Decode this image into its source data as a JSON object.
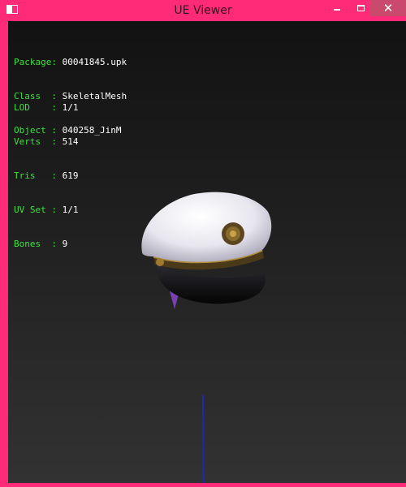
{
  "window": {
    "title": "UE Viewer",
    "accent_color": "#ff2a78",
    "minimize_icon": "minimize-icon",
    "maximize_icon": "maximize-icon",
    "close_icon": "close-icon"
  },
  "info": [
    {
      "key": "Package:",
      "value": "00041845.upk"
    },
    {
      "key": "Class  :",
      "value": "SkeletalMesh"
    },
    {
      "key": "Object :",
      "value": "040258_JinM"
    }
  ],
  "stats": [
    {
      "key": "LOD    :",
      "value": "1/1"
    },
    {
      "key": "Verts  :",
      "value": "514"
    },
    {
      "key": "Tris   :",
      "value": "619"
    },
    {
      "key": "UV Set :",
      "value": "1/1"
    },
    {
      "key": "Bones  :",
      "value": "9"
    }
  ],
  "viewport": {
    "mesh": "captain-hat-mesh",
    "axis_color": "#1a2aaa"
  }
}
